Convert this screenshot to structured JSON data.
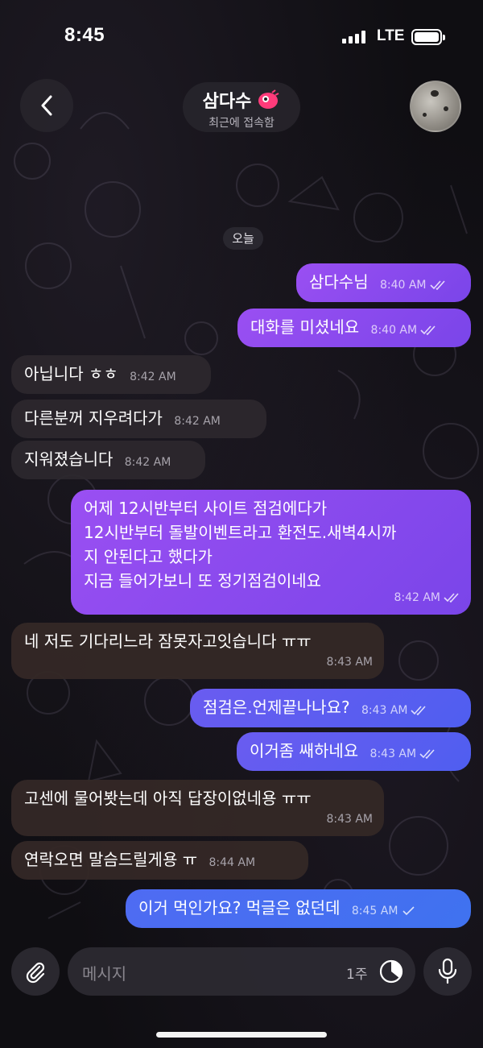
{
  "status_bar": {
    "time": "8:45",
    "network": "LTE"
  },
  "header": {
    "name": "삼다수",
    "status": "최근에 접속함",
    "back_icon": "chevron-left-icon",
    "emoji_icon": "pink-emoji-icon"
  },
  "date_separator": "오늘",
  "messages": [
    {
      "dir": "out",
      "text": "삼다수님",
      "time": "8:40 AM",
      "read": true
    },
    {
      "dir": "out",
      "text": "대화를 미셨네요",
      "time": "8:40 AM",
      "read": true
    },
    {
      "dir": "in",
      "text": "아닙니다 ㅎㅎ",
      "time": "8:42 AM"
    },
    {
      "dir": "in",
      "text": "다른분꺼 지우려다가",
      "time": "8:42 AM"
    },
    {
      "dir": "in",
      "text": "지워졌습니다",
      "time": "8:42 AM"
    },
    {
      "dir": "out",
      "lines": [
        "어제 12시반부터 사이트 점검에다가",
        "12시반부터 돌발이벤트라고 환전도.새벽4시까",
        "지 안된다고 했다가",
        "지금 들어가보니 또 정기점검이네요"
      ],
      "time": "8:42 AM",
      "read": true
    },
    {
      "dir": "in",
      "text": "네 저도 기다리느라 잠못자고잇습니다 ㅠㅠ",
      "time": "8:43 AM"
    },
    {
      "dir": "out",
      "text": "점검은.언제끝나나요?",
      "time": "8:43 AM",
      "read": true
    },
    {
      "dir": "out",
      "text": "이거좀 쌔하네요",
      "time": "8:43 AM",
      "read": true
    },
    {
      "dir": "in",
      "text": "고센에 물어봣는데 아직 답장이없네용 ㅠㅠ",
      "time": "8:43 AM"
    },
    {
      "dir": "in",
      "text": "연락오면 말슴드릴게용 ㅠ",
      "time": "8:44 AM"
    },
    {
      "dir": "out",
      "text": "이거 먹인가요? 먹글은 없던데",
      "time": "8:45 AM",
      "read": true
    }
  ],
  "input": {
    "placeholder": "메시지",
    "timer_label": "1주",
    "attach_icon": "paperclip-icon",
    "timer_icon": "timer-icon",
    "mic_icon": "microphone-icon"
  },
  "colors": {
    "outgoing": "#8a4ff0",
    "outgoing_blue": "#4f6bf2",
    "incoming": "#2c282e",
    "background": "#0f0e12"
  }
}
